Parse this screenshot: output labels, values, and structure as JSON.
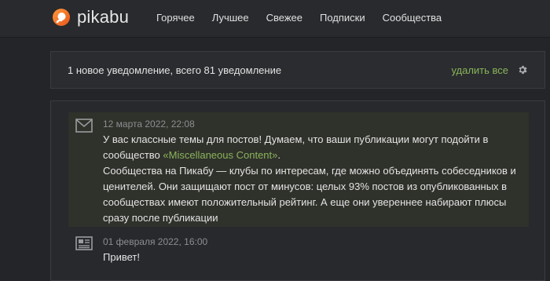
{
  "header": {
    "logo_text": "pikabu",
    "nav": [
      "Горячее",
      "Лучшее",
      "Свежее",
      "Подписки",
      "Сообщества"
    ]
  },
  "notifications": {
    "summary": "1 новое уведомление, всего 81 уведомление",
    "delete_all": "удалить все",
    "settings_icon": "gear-icon"
  },
  "messages": [
    {
      "icon": "envelope-icon",
      "unread": true,
      "date": "12 марта 2022, 22:08",
      "line1_before": "У вас классные темы для постов! Думаем, что ваши публикации могут подойти в сообщество ",
      "link": "«Miscellaneous Content»",
      "line1_after": ".",
      "paragraph2": "Сообщества на Пикабу — клубы по интересам, где можно объединять собеседников и ценителей. Они защищают пост от минусов: целых 93% постов из опубликованных в сообществах имеют положительный рейтинг. А еще они увереннее набирают плюсы сразу после публикации"
    },
    {
      "icon": "newspaper-icon",
      "unread": false,
      "date": "01 февраля 2022, 16:00",
      "text": "Привет!"
    }
  ],
  "colors": {
    "background": "#232528",
    "header": "#282a2d",
    "accent_green": "#8ab45a",
    "logo_orange": "#f36f21",
    "unread_bg": "#2f312b"
  }
}
